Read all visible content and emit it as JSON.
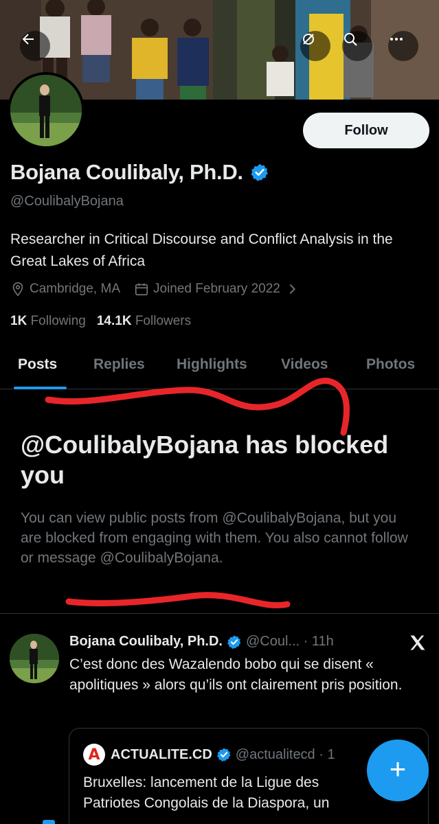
{
  "header": {
    "back_icon": "arrow-left-icon",
    "action_icons": [
      "refresh-icon",
      "search-icon",
      "more-icon"
    ]
  },
  "profile": {
    "name": "Bojana Coulibaly, Ph.D.",
    "handle": "@CoulibalyBojana",
    "bio": "Researcher in Critical Discourse and Conflict Analysis in the Great Lakes of Africa",
    "location": "Cambridge, MA",
    "joined": "Joined February 2022",
    "following_count": "1K",
    "following_label": "Following",
    "followers_count": "14.1K",
    "followers_label": "Followers",
    "follow_label": "Follow"
  },
  "tabs": [
    {
      "label": "Posts",
      "active": true
    },
    {
      "label": "Replies",
      "active": false
    },
    {
      "label": "Highlights",
      "active": false
    },
    {
      "label": "Videos",
      "active": false
    },
    {
      "label": "Photos",
      "active": false
    }
  ],
  "blocked": {
    "title": "@CoulibalyBojana has blocked you",
    "description": "You can view public posts from @CoulibalyBojana, but you are blocked from engaging with them. You also cannot follow or message @CoulibalyBojana."
  },
  "post": {
    "author": "Bojana Coulibaly, Ph.D.",
    "handle_time": "@Coul... · 11h",
    "text": "C’est donc des Wazalendo bobo qui se disent « apolitiques » alors qu’ils ont clairement pris position.",
    "quote": {
      "logo_letter": "A",
      "author": "ACTUALITE.CD",
      "handle": "@actualitecd · 1",
      "text": "Bruxelles: lancement de la Ligue des Patriotes Congolais de la Diaspora, un"
    }
  },
  "fab_label": "+",
  "colors": {
    "accent": "#1d9bf0",
    "background": "#000000",
    "text_primary": "#e7e9ea",
    "text_secondary": "#71767b",
    "annotation_red": "#e8262a"
  }
}
